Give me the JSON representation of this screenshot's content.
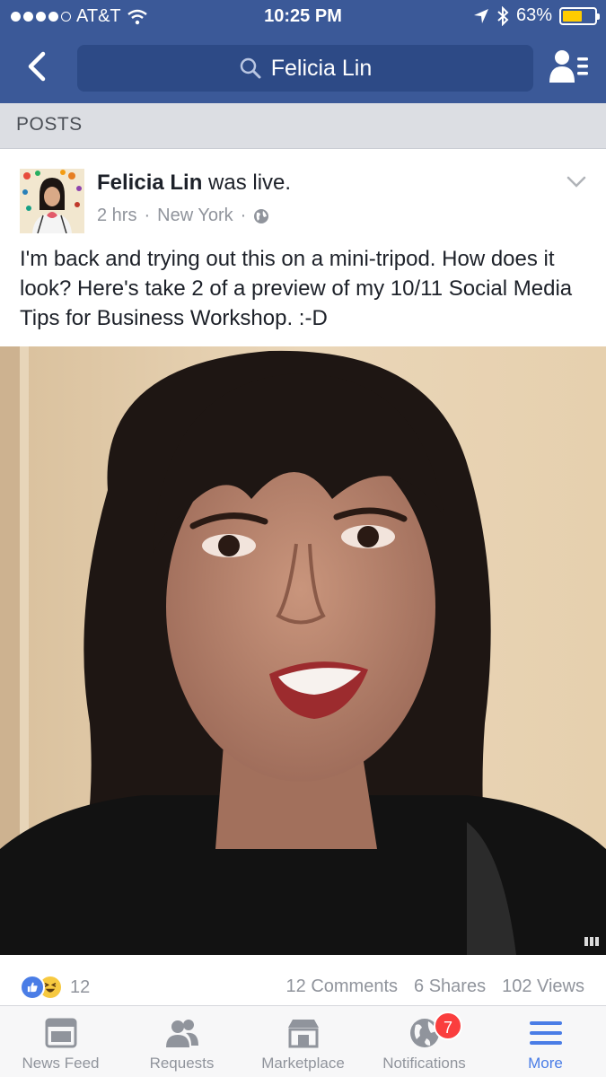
{
  "status_bar": {
    "carrier": "AT&T",
    "time": "10:25 PM",
    "battery": "63%",
    "battery_level": 0.63,
    "battery_color": "#ffcc00"
  },
  "nav": {
    "search_text": "Felicia Lin",
    "header_color": "#3b5998"
  },
  "section": {
    "label": "POSTS"
  },
  "post": {
    "author": "Felicia Lin",
    "action": "was live.",
    "time": "2 hrs",
    "location": "New York",
    "separator": "·",
    "text": "I'm back and trying out this on a mini-tripod. How does it look? Here's take 2 of a preview of my 10/11 Social Media Tips for Business Workshop. :-D"
  },
  "stats": {
    "reactions_count": "12",
    "comments": "12 Comments",
    "shares": "6 Shares",
    "views": "102 Views"
  },
  "tabs": [
    {
      "label": "News Feed",
      "icon": "news-feed-icon"
    },
    {
      "label": "Requests",
      "icon": "friend-requests-icon"
    },
    {
      "label": "Marketplace",
      "icon": "marketplace-icon"
    },
    {
      "label": "Notifications",
      "icon": "globe-icon",
      "badge": "7"
    },
    {
      "label": "More",
      "icon": "hamburger-menu-icon",
      "active": true
    }
  ],
  "colors": {
    "accent": "#4a7de6",
    "badge": "#fa3e3e"
  }
}
